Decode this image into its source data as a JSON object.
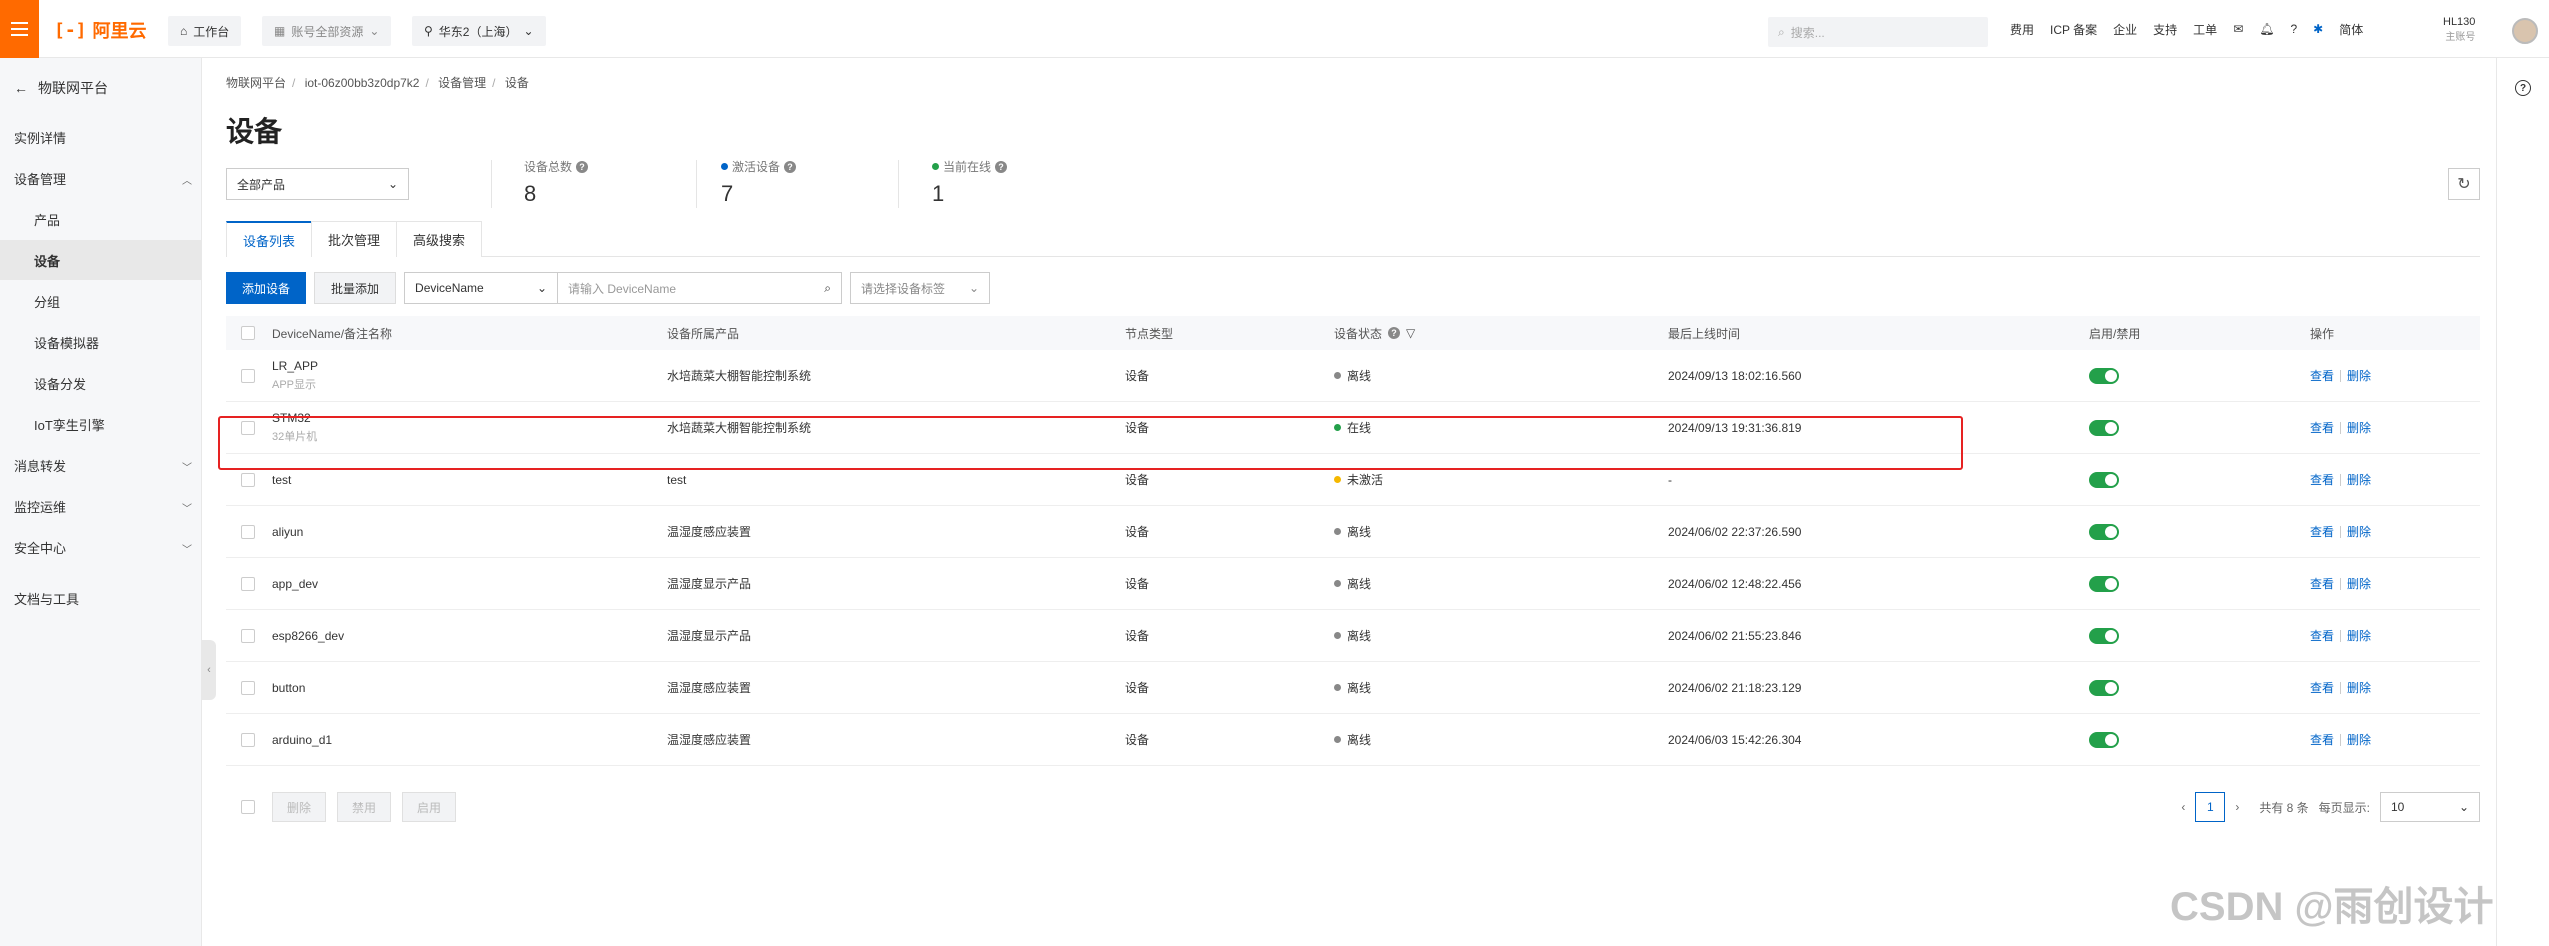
{
  "topbar": {
    "logo_text": "阿里云",
    "logo_mark": "[-]",
    "workbench": "工作台",
    "resources": "账号全部资源",
    "region": "华东2（上海）",
    "search_placeholder": "搜索...",
    "links": [
      "费用",
      "ICP 备案",
      "企业",
      "支持",
      "工单"
    ],
    "lang": "简体",
    "user_name": "HL130",
    "user_role": "主账号"
  },
  "sidebar": {
    "back": "物联网平台",
    "items": [
      {
        "label": "实例详情"
      },
      {
        "label": "设备管理",
        "caret": "^"
      },
      {
        "label": "产品"
      },
      {
        "label": "设备"
      },
      {
        "label": "分组"
      },
      {
        "label": "设备模拟器"
      },
      {
        "label": "设备分发"
      },
      {
        "label": "IoT孪生引擎"
      },
      {
        "label": "消息转发",
        "caret": "v"
      },
      {
        "label": "监控运维",
        "caret": "v"
      },
      {
        "label": "安全中心",
        "caret": "v"
      },
      {
        "label": "文档与工具"
      }
    ]
  },
  "breadcrumb": [
    "物联网平台",
    "iot-06z00bb3z0dp7k2",
    "设备管理",
    "设备"
  ],
  "page_title": "设备",
  "product_select": "全部产品",
  "stats": [
    {
      "label": "设备总数",
      "value": "8",
      "dot": ""
    },
    {
      "label": "激活设备",
      "value": "7",
      "dot": "#0064c8"
    },
    {
      "label": "当前在线",
      "value": "1",
      "dot": "#23a04a"
    }
  ],
  "tabs": [
    "设备列表",
    "批次管理",
    "高级搜索"
  ],
  "toolbar": {
    "add_device": "添加设备",
    "batch_add": "批量添加",
    "field_select": "DeviceName",
    "search_placeholder": "请输入 DeviceName",
    "tag_placeholder": "请选择设备标签"
  },
  "table": {
    "headers": [
      "DeviceName/备注名称",
      "设备所属产品",
      "节点类型",
      "设备状态",
      "最后上线时间",
      "启用/禁用",
      "操作"
    ],
    "rows": [
      {
        "name": "LR_APP",
        "note": "APP显示",
        "product": "水培蔬菜大棚智能控制系统",
        "node": "设备",
        "status": "离线",
        "status_color": "#888888",
        "last_online": "2024/09/13 18:02:16.560",
        "op1": "查看",
        "op2": "删除"
      },
      {
        "name": "STM32",
        "note": "32单片机",
        "product": "水培蔬菜大棚智能控制系统",
        "node": "设备",
        "status": "在线",
        "status_color": "#23a04a",
        "last_online": "2024/09/13 19:31:36.819",
        "op1": "查看",
        "op2": "删除"
      },
      {
        "name": "test",
        "note": "",
        "product": "test",
        "node": "设备",
        "status": "未激活",
        "status_color": "#f5b800",
        "last_online": "-",
        "op1": "查看",
        "op2": "删除"
      },
      {
        "name": "aliyun",
        "note": "",
        "product": "温湿度感应装置",
        "node": "设备",
        "status": "离线",
        "status_color": "#888888",
        "last_online": "2024/06/02 22:37:26.590",
        "op1": "查看",
        "op2": "删除"
      },
      {
        "name": "app_dev",
        "note": "",
        "product": "温湿度显示产品",
        "node": "设备",
        "status": "离线",
        "status_color": "#888888",
        "last_online": "2024/06/02 12:48:22.456",
        "op1": "查看",
        "op2": "删除"
      },
      {
        "name": "esp8266_dev",
        "note": "",
        "product": "温湿度显示产品",
        "node": "设备",
        "status": "离线",
        "status_color": "#888888",
        "last_online": "2024/06/02 21:55:23.846",
        "op1": "查看",
        "op2": "删除"
      },
      {
        "name": "button",
        "note": "",
        "product": "温湿度感应装置",
        "node": "设备",
        "status": "离线",
        "status_color": "#888888",
        "last_online": "2024/06/02 21:18:23.129",
        "op1": "查看",
        "op2": "删除"
      },
      {
        "name": "arduino_d1",
        "note": "",
        "product": "温湿度感应装置",
        "node": "设备",
        "status": "离线",
        "status_color": "#888888",
        "last_online": "2024/06/03 15:42:26.304",
        "op1": "查看",
        "op2": "删除"
      }
    ]
  },
  "footer": {
    "delete": "删除",
    "disable": "禁用",
    "enable": "启用",
    "total": "共有 8 条",
    "per_page_label": "每页显示:",
    "page": "1",
    "page_size": "10"
  },
  "watermark": "CSDN @雨创设计"
}
